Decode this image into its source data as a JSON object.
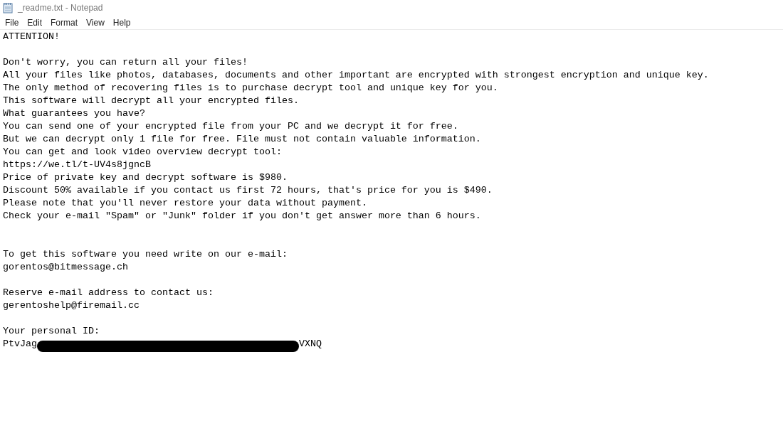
{
  "window": {
    "title": "_readme.txt - Notepad"
  },
  "menu": [
    "File",
    "Edit",
    "Format",
    "View",
    "Help"
  ],
  "lines": [
    {
      "kind": "text",
      "text": "ATTENTION!"
    },
    {
      "kind": "blank"
    },
    {
      "kind": "text",
      "text": "Don't worry, you can return all your files!"
    },
    {
      "kind": "text",
      "text": "All your files like photos, databases, documents and other important are encrypted with strongest encryption and unique key."
    },
    {
      "kind": "text",
      "text": "The only method of recovering files is to purchase decrypt tool and unique key for you."
    },
    {
      "kind": "text",
      "text": "This software will decrypt all your encrypted files."
    },
    {
      "kind": "text",
      "text": "What guarantees you have?"
    },
    {
      "kind": "text",
      "text": "You can send one of your encrypted file from your PC and we decrypt it for free."
    },
    {
      "kind": "text",
      "text": "But we can decrypt only 1 file for free. File must not contain valuable information."
    },
    {
      "kind": "text",
      "text": "You can get and look video overview decrypt tool:"
    },
    {
      "kind": "text",
      "text": "https://we.tl/t-UV4s8jgncB"
    },
    {
      "kind": "text",
      "text": "Price of private key and decrypt software is $980."
    },
    {
      "kind": "text",
      "text": "Discount 50% available if you contact us first 72 hours, that's price for you is $490."
    },
    {
      "kind": "text",
      "text": "Please note that you'll never restore your data without payment."
    },
    {
      "kind": "text",
      "text": "Check your e-mail \"Spam\" or \"Junk\" folder if you don't get answer more than 6 hours."
    },
    {
      "kind": "blank"
    },
    {
      "kind": "blank"
    },
    {
      "kind": "text",
      "text": "To get this software you need write on our e-mail:"
    },
    {
      "kind": "text",
      "text": "gorentos@bitmessage.ch"
    },
    {
      "kind": "blank"
    },
    {
      "kind": "text",
      "text": "Reserve e-mail address to contact us:"
    },
    {
      "kind": "text",
      "text": "gerentoshelp@firemail.cc"
    },
    {
      "kind": "blank"
    },
    {
      "kind": "text",
      "text": "Your personal ID:"
    },
    {
      "kind": "redacted",
      "before": "PtvJag",
      "after": "VXNQ"
    }
  ]
}
